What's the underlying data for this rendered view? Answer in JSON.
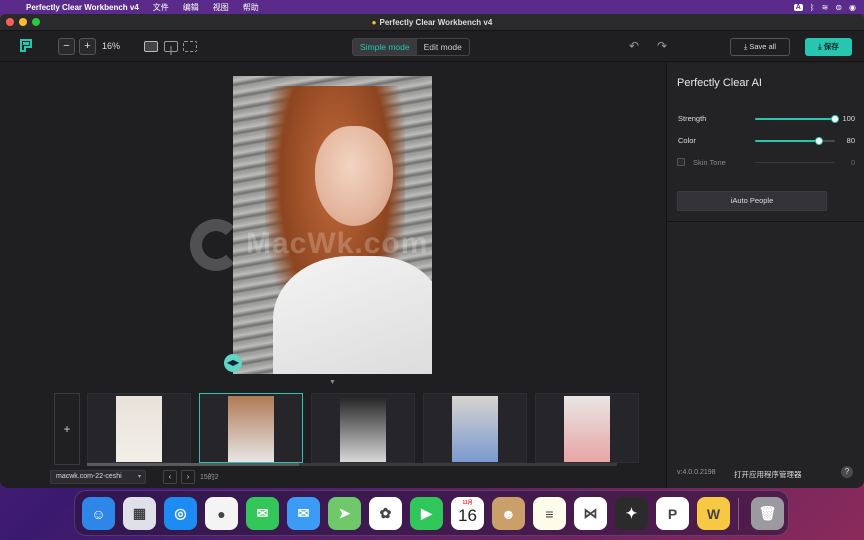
{
  "menubar": {
    "app_name": "Perfectly Clear Workbench v4",
    "menus": [
      "文件",
      "编辑",
      "视图",
      "帮助"
    ],
    "input_badge": "A"
  },
  "window": {
    "title": "Perfectly Clear Workbench v4"
  },
  "toolbar": {
    "zoom_minus": "−",
    "zoom_plus": "+",
    "zoom_level": "16%",
    "mode_simple": "Simple mode",
    "mode_edit": "Edit mode",
    "save_all": "Save all",
    "save": "保存",
    "undo_icon": "↶",
    "redo_icon": "↷"
  },
  "canvas": {
    "watermark": "MacWk.com",
    "compare_handle": "◀▶",
    "collapse_arrow": "▼"
  },
  "filmstrip": {
    "add_label": "+",
    "scroll_progress": 0.4,
    "folder": "macwk.com-22-ceshi",
    "page_count": "15的2",
    "prev": "‹",
    "next": "›",
    "thumbs": [
      {
        "name": "thumb-1",
        "colors": [
          "#e9e2da",
          "#f2efe9"
        ]
      },
      {
        "name": "thumb-2",
        "colors": [
          "#b07a55",
          "#e6e6e6"
        ]
      },
      {
        "name": "thumb-3",
        "colors": [
          "#222222",
          "#d9d9d9"
        ]
      },
      {
        "name": "thumb-4",
        "colors": [
          "#d8d4cf",
          "#7a9ad0"
        ]
      },
      {
        "name": "thumb-5",
        "colors": [
          "#e9e6e4",
          "#e8a5a5"
        ]
      }
    ]
  },
  "panel": {
    "title": "Perfectly Clear AI",
    "strength_label": "Strength",
    "strength_value": "100",
    "strength_fraction": 1.0,
    "color_label": "Color",
    "color_value": "80",
    "color_fraction": 0.8,
    "skin_tone_label": "Skin Tone",
    "skin_tone_value": "0",
    "auto_people": "iAuto People",
    "version": "v:4.0.0.2198",
    "app_manager": "打开应用程序管理器",
    "help": "?"
  },
  "dock": {
    "calendar_month": "11月",
    "calendar_day": "16",
    "apps": [
      {
        "name": "finder-icon",
        "color": "#2f86e9",
        "glyph": "☺"
      },
      {
        "name": "launchpad-icon",
        "color": "#e0e0e8",
        "glyph": "▦"
      },
      {
        "name": "safari-icon",
        "color": "#1d8cf2",
        "glyph": "◎"
      },
      {
        "name": "chrome-icon",
        "color": "#f4f4f4",
        "glyph": "●"
      },
      {
        "name": "messages-icon",
        "color": "#33c759",
        "glyph": "✉"
      },
      {
        "name": "mail-icon",
        "color": "#3b9bf5",
        "glyph": "✉"
      },
      {
        "name": "maps-icon",
        "color": "#6fc86a",
        "glyph": "➤"
      },
      {
        "name": "photos-icon",
        "color": "#ffffff",
        "glyph": "✿"
      },
      {
        "name": "facetime-icon",
        "color": "#31c65a",
        "glyph": "▶"
      },
      {
        "name": "calendar-icon",
        "color": "#ffffff",
        "glyph": ""
      },
      {
        "name": "contacts-icon",
        "color": "#c9a06a",
        "glyph": "☻"
      },
      {
        "name": "notes-icon",
        "color": "#fdfbe9",
        "glyph": "≡"
      },
      {
        "name": "vscode-icon",
        "color": "#ffffff",
        "glyph": "⋈"
      },
      {
        "name": "tes-icon",
        "color": "#2b2b2b",
        "glyph": "✦"
      },
      {
        "name": "powerpoint-icon",
        "color": "#ffffff",
        "glyph": "P"
      },
      {
        "name": "wps-icon",
        "color": "#f7c844",
        "glyph": "W"
      },
      {
        "name": "trash-icon",
        "color": "#9a9aa0",
        "glyph": "🗑"
      }
    ]
  }
}
